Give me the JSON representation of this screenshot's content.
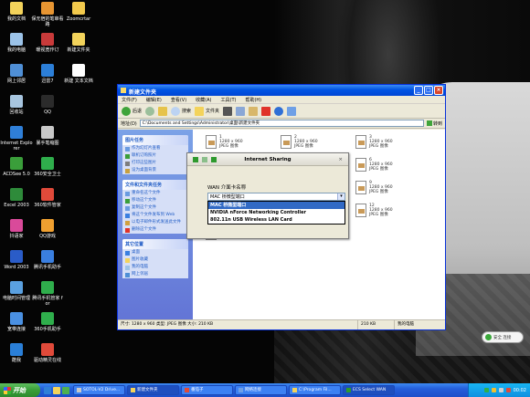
{
  "desktop": {
    "icons": [
      {
        "label": "我的文档",
        "color": "#f3d35b"
      },
      {
        "label": "保无宿的笔审看路",
        "color": "#e79532"
      },
      {
        "label": "Zoomcrtar",
        "color": "#f2c94c"
      },
      {
        "label": "我的电脑",
        "color": "#9cc3e8"
      },
      {
        "label": "暖视宽作订",
        "color": "#c83a3a"
      },
      {
        "label": "新建文件夹",
        "color": "#f3d35b"
      },
      {
        "label": "网上邻居",
        "color": "#4f8fd6"
      },
      {
        "label": "迅雷7",
        "color": "#2c7fd8"
      },
      {
        "label": "新建 文本文档",
        "color": "#ffffff"
      },
      {
        "label": "回收站",
        "color": "#a8c6e0"
      },
      {
        "label": "QQ",
        "color": "#2b2b2b"
      },
      {
        "label": "Internet Explorer",
        "color": "#2f7fd8"
      },
      {
        "label": "暴手笔缩图",
        "color": "#c8c8c8"
      },
      {
        "label": "ACDSee 5.0",
        "color": "#3a9e3a"
      },
      {
        "label": "360安全卫士",
        "color": "#2fae4c"
      },
      {
        "label": "Excel 2003",
        "color": "#2e8b3a"
      },
      {
        "label": "360软件管家",
        "color": "#e04a3a"
      },
      {
        "label": "抖语家",
        "color": "#d94a9a"
      },
      {
        "label": "QQ游戏",
        "color": "#f0a030"
      },
      {
        "label": "Word 2003",
        "color": "#2a5cc8"
      },
      {
        "label": "腾讯手机助手",
        "color": "#3a7fe0"
      },
      {
        "label": "电脑时间管理",
        "color": "#5aa0e0"
      },
      {
        "label": "腾讯手机管家 for",
        "color": "#2fae4c"
      },
      {
        "label": "宽带连接",
        "color": "#4a90e2"
      },
      {
        "label": "360手机助手",
        "color": "#2fae4c"
      },
      {
        "label": "酷我",
        "color": "#2a7fd8"
      },
      {
        "label": "驱动精灵在线",
        "color": "#e04a3a"
      }
    ]
  },
  "explorer": {
    "title": "新建文件夹",
    "menu": [
      "文件(F)",
      "编辑(E)",
      "查看(V)",
      "收藏(A)",
      "工具(T)",
      "帮助(H)"
    ],
    "toolbar": {
      "back": "后退",
      "search": "搜索",
      "folders": "文件夹"
    },
    "address_label": "地址(D)",
    "address_value": "C:\\Documents and Settings\\Administrator\\桌面\\新建文件夹",
    "go_label": "转到",
    "taskpane": {
      "picture_tasks": {
        "title": "图片任务",
        "items": [
          "作为幻灯片查看",
          "联机订购照片",
          "打印这些图片",
          "设为桌面背景"
        ]
      },
      "file_tasks": {
        "title": "文件和文件夹任务",
        "items": [
          "重命名这个文件",
          "移动这个文件",
          "复制这个文件",
          "将这个文件发布到 Web",
          "以电子邮件形式发送此文件",
          "删除这个文件"
        ]
      },
      "other_places": {
        "title": "其它位置",
        "items": [
          "桌面",
          "图片收藏",
          "我的电脑",
          "网上邻居"
        ]
      }
    },
    "files": [
      {
        "name": "1",
        "dims": "1280 x 960",
        "type": "JPEG 图像"
      },
      {
        "name": "2",
        "dims": "1280 x 960",
        "type": "JPEG 图像"
      },
      {
        "name": "3",
        "dims": "1280 x 960",
        "type": "JPEG 图像"
      },
      {
        "name": "4",
        "dims": "1280 x 960",
        "type": "JPEG 图像"
      },
      {
        "name": "5",
        "dims": "1280 x 960",
        "type": "JPEG 图像"
      },
      {
        "name": "6",
        "dims": "1280 x 960",
        "type": "JPEG 图像"
      },
      {
        "name": "7",
        "dims": "1280 x 960",
        "type": "JPEG 图像"
      },
      {
        "name": "8",
        "dims": "1280 x 960",
        "type": "JPEG 图像"
      },
      {
        "name": "9",
        "dims": "1280 x 960",
        "type": "JPEG 图像"
      },
      {
        "name": "10",
        "dims": "1280 x 960",
        "type": "JPEG 图像"
      },
      {
        "name": "11",
        "dims": "1280 x 960",
        "type": "JPEG 图像"
      },
      {
        "name": "12",
        "dims": "1280 x 960",
        "type": "JPEG 图像"
      },
      {
        "name": "13",
        "dims": "1280 x 960",
        "type": "JPEG 图像"
      }
    ],
    "status": {
      "info": "尺寸: 1280 x 960 类型: JPEG 图像 大小: 210 KB",
      "size": "210 KB",
      "location": "我的电脑"
    }
  },
  "dialog": {
    "title": "Internet Sharing",
    "close": "×",
    "label": "WAN 介面卡名称",
    "selected": "MAC 桥微型端口",
    "options": [
      "MAC 桥微型端口",
      "NVIDIA nForce Networking Controller",
      "802.11n USB Wireless LAN Card"
    ]
  },
  "taskbar": {
    "start": "开始",
    "tasks": [
      "SOTOL-V2 Drive...",
      "新建文件夹",
      "番茄子",
      "网络连接",
      "C:\\Program Fil...",
      "ECS Select WAN"
    ],
    "clock": "00:02"
  },
  "bubble": {
    "text": "安全 连接"
  },
  "colors": {
    "xp_blue": "#0054e3",
    "selection": "#316ac5",
    "start_green": "#389e38"
  }
}
